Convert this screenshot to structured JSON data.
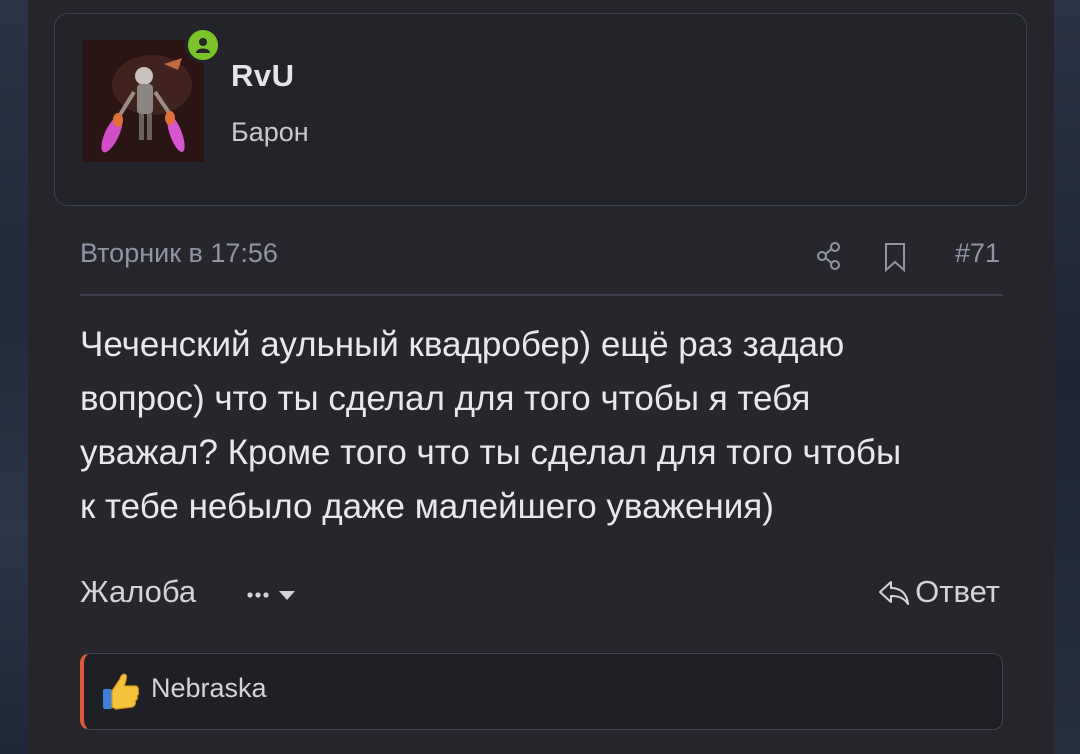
{
  "user": {
    "name": "RvU",
    "title": "Барон",
    "avatar": "avatar-image",
    "online_icon": "user-online-icon",
    "online_color": "#7cc329"
  },
  "post": {
    "date": "Вторник в 17:56",
    "number": "#71",
    "share_icon": "share-icon",
    "bookmark_icon": "bookmark-icon",
    "lines": [
      "Чеченский аульный квадробер) ещё раз задаю",
      "вопрос) что ты сделал для того чтобы я тебя",
      "уважал? Кроме того что ты сделал для того чтобы",
      "к тебе небыло даже малейшего уважения)"
    ]
  },
  "actions": {
    "report": "Жалоба",
    "more": "•••",
    "reply": "Ответ"
  },
  "reactions": {
    "emoji": "thumbs-up-icon",
    "users": "Nebraska",
    "accent": "#e0583f"
  }
}
